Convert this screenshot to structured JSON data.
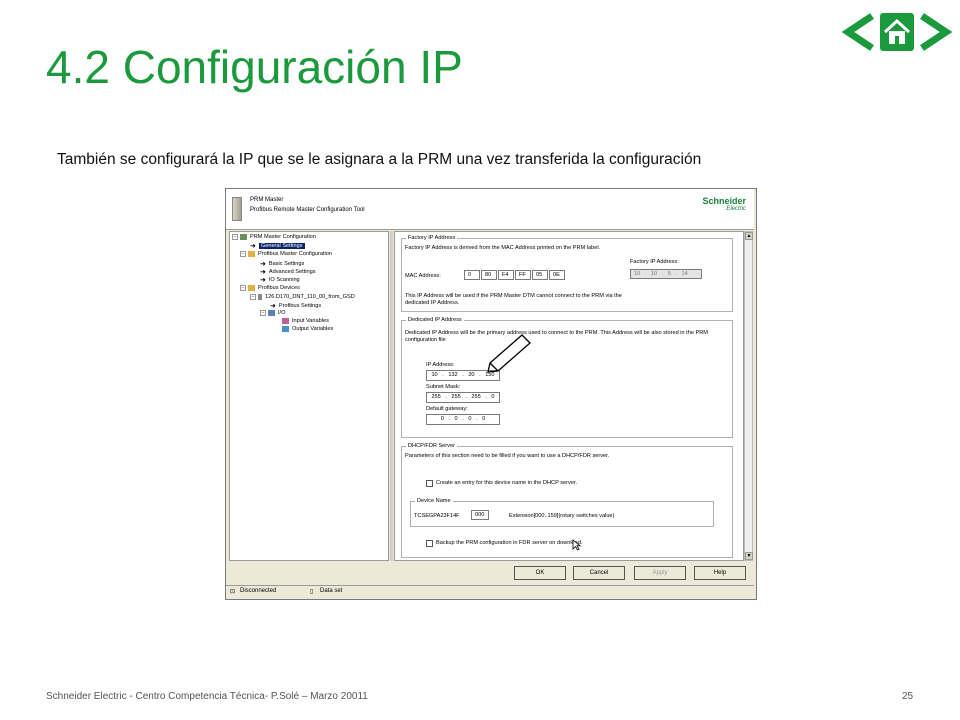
{
  "slide": {
    "title": "4.2 Configuración IP",
    "subtitle": "También se configurará la IP que se le asignara a la PRM una vez transferida la configuración",
    "footer_left": "Schneider Electric - Centro Competencia Técnica- P.Solé – Marzo 20011",
    "page_number": "25",
    "accent_color": "#1a9a3c",
    "nav": {
      "prev_icon": "chevron-left-icon",
      "home_icon": "home-icon",
      "next_icon": "chevron-right-icon"
    }
  },
  "window": {
    "header": {
      "title": "PRM Master",
      "subtitle": "Profibus Remote Master Configuration Tool",
      "brand": "Schneider",
      "brand_sub": "Electric"
    },
    "tree": {
      "root": "PRM Master Configuration",
      "general": "General Settings",
      "master_config": "Profibus Master Configuration",
      "basic": "Basic Settings",
      "advanced": "Advanced Settings",
      "io_scanning": "IO Scanning",
      "devices": "Profibus Devices",
      "device": "126.D170_DNT_110_00_from_GSD",
      "profibus_settings": "Profibus Settings",
      "io": "I/O",
      "input_vars": "Input Variables",
      "output_vars": "Output Variables"
    },
    "factory": {
      "legend": "Factory IP Address",
      "desc": "Factory IP Address is derived from the MAC Address printed on the PRM label.",
      "mac_label": "MAC Address:",
      "mac": [
        "0",
        "80",
        "F4",
        "FF",
        "05",
        "0E"
      ],
      "factory_ip_label": "Factory IP Address:",
      "factory_ip": "10 . 10 . 5 . 14",
      "note": "This IP Address will be used if the PRM Master DTM cannot connect to the PRM via the dedicated IP Address."
    },
    "dedicated": {
      "legend": "Dedicated IP Address",
      "desc": "Dedicated IP Address will be the primary address used to connect to the PRM. This Address will be also stored in the PRM configuration file",
      "ip_label": "IP Address:",
      "ip": "10 . 132 . 20 . 150",
      "mask_label": "Subnet Mask:",
      "mask": "255 . 255 . 255 . 0",
      "gw_label": "Default gateway:",
      "gw": "0 . 0 . 0 . 0"
    },
    "dhcp": {
      "legend": "DHCP/FDR Server",
      "desc": "Parameters of this section need to be filled if you want to use a DHCP/FDR server.",
      "create_entry": "Create an entry for this device name in the DHCP server.",
      "device_name_legend": "Device Name",
      "device_name": "TCSEGPA23F14F",
      "extension": "000",
      "extension_label": "Extension[000..159](rotary switches value)",
      "backup": "Backup the PRM configuration in FDR server on download."
    },
    "buttons": {
      "ok": "OK",
      "cancel": "Cancel",
      "apply": "Apply",
      "help": "Help"
    },
    "status": {
      "connection": "Disconnected",
      "dataset": "Data set"
    }
  }
}
